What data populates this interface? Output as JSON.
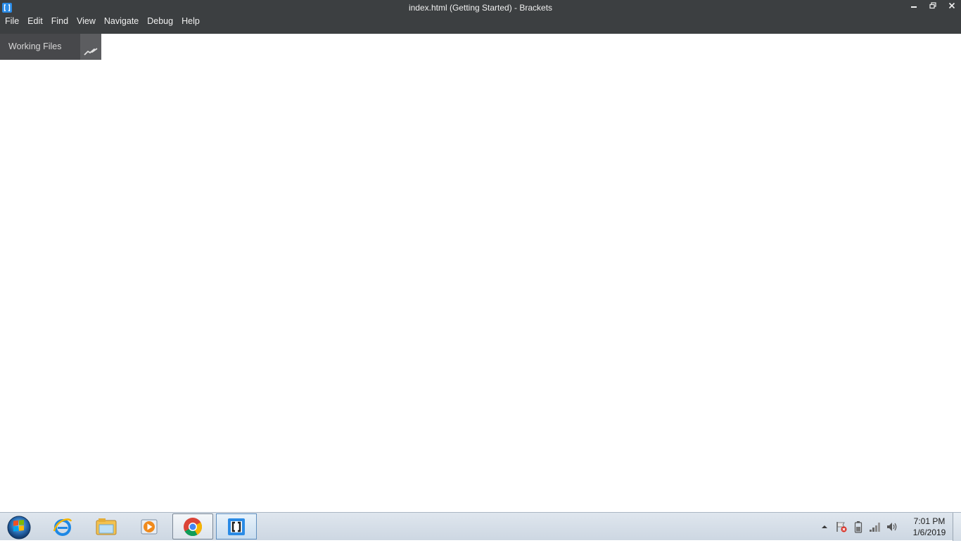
{
  "window": {
    "title": "index.html (Getting Started) - Brackets",
    "minimize_icon": "minimize-icon",
    "restore_icon": "restore-icon",
    "close_icon": "close-icon"
  },
  "menu": {
    "items": [
      {
        "label": "File"
      },
      {
        "label": "Edit"
      },
      {
        "label": "Find"
      },
      {
        "label": "View"
      },
      {
        "label": "Navigate"
      },
      {
        "label": "Debug"
      },
      {
        "label": "Help"
      }
    ]
  },
  "sidebar": {
    "working_files_label": "Working Files",
    "live_preview_icon": "live-preview-icon"
  },
  "taskbar": {
    "apps": [
      {
        "name": "internet-explorer-icon"
      },
      {
        "name": "file-explorer-icon"
      },
      {
        "name": "media-player-icon"
      },
      {
        "name": "chrome-icon"
      },
      {
        "name": "brackets-icon"
      }
    ],
    "clock": {
      "time": "7:01 PM",
      "date": "1/6/2019"
    }
  },
  "colors": {
    "titlebar": "#3c3f41",
    "sidebar_header": "#47484b",
    "accent": "#2a8be6"
  }
}
